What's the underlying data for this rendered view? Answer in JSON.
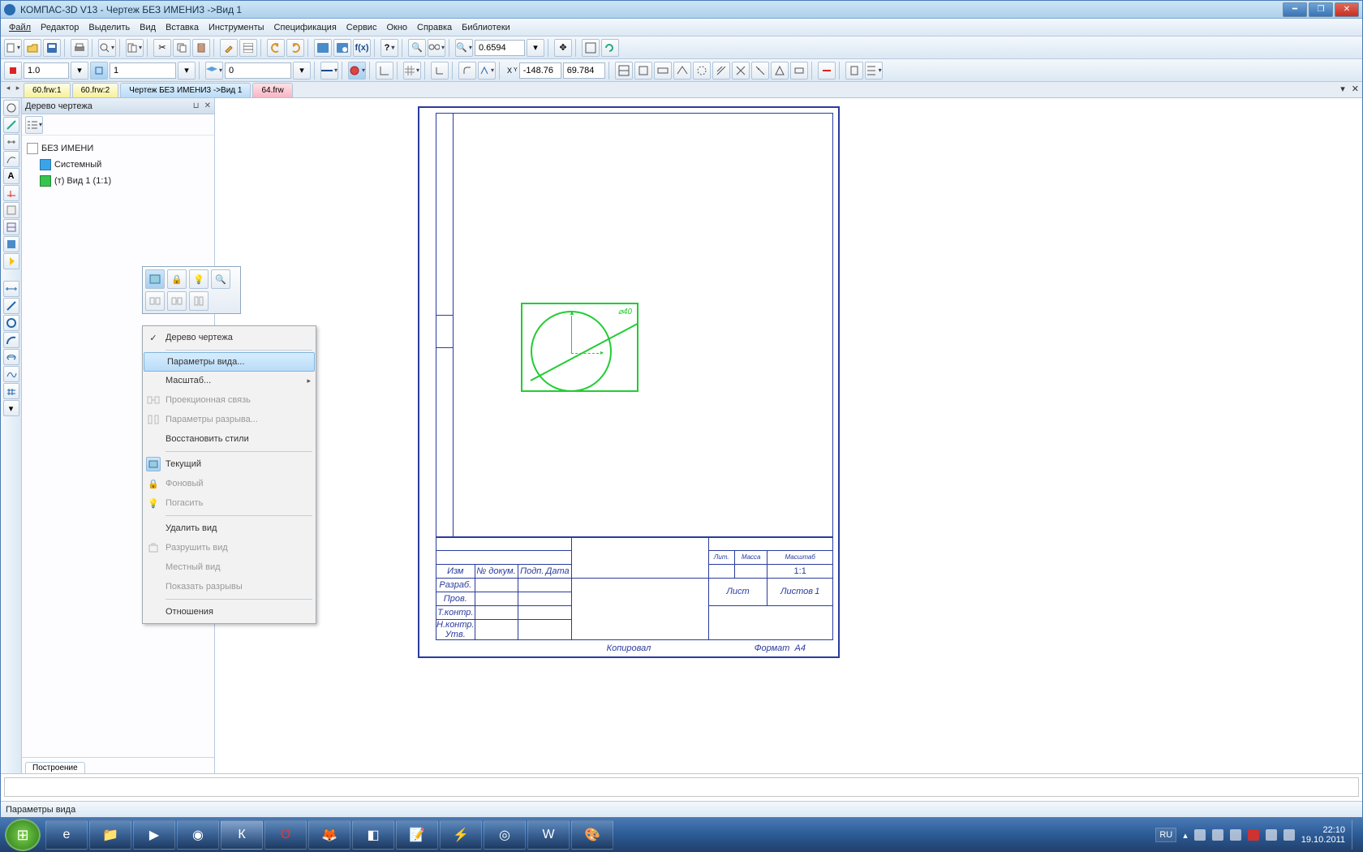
{
  "window_title": "КОМПАС-3D V13 - Чертеж БЕЗ ИМЕНИ3 ->Вид 1",
  "menu": [
    "Файл",
    "Редактор",
    "Выделить",
    "Вид",
    "Вставка",
    "Инструменты",
    "Спецификация",
    "Сервис",
    "Окно",
    "Справка",
    "Библиотеки"
  ],
  "toolbar1": {
    "zoom_value": "0.6594"
  },
  "toolbar2": {
    "scale": "1.0",
    "step": "1",
    "angle": "0",
    "coord_x": "-148.76",
    "coord_y": "69.784"
  },
  "doc_tabs": [
    {
      "label": "60.frw:1",
      "cls": "yellow"
    },
    {
      "label": "60.frw:2",
      "cls": "yellow"
    },
    {
      "label": "Чертеж БЕЗ ИМЕНИ3 ->Вид 1",
      "cls": "active"
    },
    {
      "label": "64.frw",
      "cls": "pink"
    }
  ],
  "tree": {
    "title": "Дерево чертежа",
    "root": "БЕЗ ИМЕНИ",
    "layer": "Системный",
    "view": "(т) Вид 1 (1:1)",
    "footer_tab": "Построение"
  },
  "context_menu": [
    {
      "label": "Дерево чертежа",
      "check": true
    },
    {
      "divider": true
    },
    {
      "label": "Параметры вида...",
      "highlight": true
    },
    {
      "label": "Масштаб...",
      "sub": true
    },
    {
      "label": "Проекционная связь",
      "disabled": true,
      "icon": "link"
    },
    {
      "label": "Параметры разрыва...",
      "disabled": true,
      "icon": "break"
    },
    {
      "label": "Восстановить стили"
    },
    {
      "divider": true
    },
    {
      "label": "Текущий",
      "icon": "current",
      "icon_active": true
    },
    {
      "label": "Фоновый",
      "disabled": true,
      "icon": "lock"
    },
    {
      "label": "Погасить",
      "disabled": true,
      "icon": "bulb"
    },
    {
      "divider": true
    },
    {
      "label": "Удалить вид"
    },
    {
      "label": "Разрушить вид",
      "disabled": true,
      "icon": "destroy"
    },
    {
      "label": "Местный вид",
      "disabled": true
    },
    {
      "label": "Показать разрывы",
      "disabled": true
    },
    {
      "divider": true
    },
    {
      "label": "Отношения"
    }
  ],
  "drawing": {
    "dimension_label": "⌀40",
    "stamp": {
      "scale": "1:1",
      "lit": "Лит.",
      "mass": "Масса",
      "mscale": "Масштаб",
      "izm": "Изм",
      "list_no": "№ докум.",
      "sign": "Подп.",
      "date": "Дата",
      "razrab": "Разраб.",
      "prov": "Пров.",
      "tkontr": "Т.контр.",
      "nkontr": "Н.контр.",
      "utv": "Утв.",
      "list": "Лист",
      "listov": "Листов",
      "one": "1"
    },
    "copied": "Копировал",
    "format": "Формат",
    "a4": "A4"
  },
  "status_text": "Параметры вида",
  "tray": {
    "lang": "RU",
    "time": "22:10",
    "date": "19.10.2011"
  }
}
